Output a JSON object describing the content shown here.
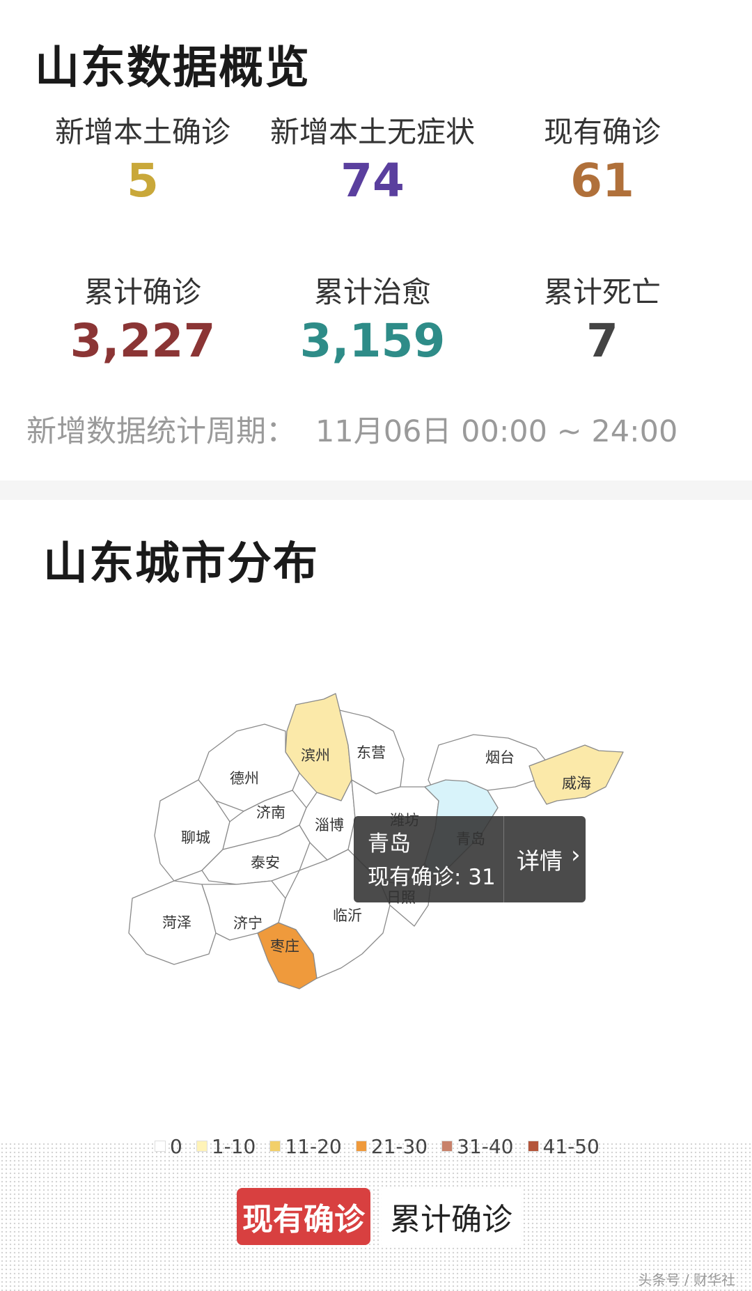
{
  "overview": {
    "title": "山东数据概览",
    "stats": [
      {
        "label": "新增本土确诊",
        "value": "5",
        "color": "#c9a83a"
      },
      {
        "label": "新增本土无症状",
        "value": "74",
        "color": "#5a3f9e"
      },
      {
        "label": "现有确诊",
        "value": "61",
        "color": "#b0703a"
      },
      {
        "label": "累计确诊",
        "value": "3,227",
        "color": "#8b3535"
      },
      {
        "label": "累计治愈",
        "value": "3,159",
        "color": "#2e8c88"
      },
      {
        "label": "累计死亡",
        "value": "7",
        "color": "#444444"
      }
    ],
    "period_label": "新增数据统计周期：",
    "period_value": "11月06日 00:00 ~ 24:00"
  },
  "city": {
    "title": "山东城市分布",
    "cities": [
      "滨州",
      "东营",
      "烟台",
      "德州",
      "威海",
      "济南",
      "淄博",
      "潍坊",
      "青岛",
      "聊城",
      "泰安",
      "日照",
      "菏泽",
      "济宁",
      "临沂",
      "枣庄"
    ],
    "tooltip": {
      "city": "青岛",
      "metric": "现有确诊: 31",
      "detail": "详情"
    },
    "legend": [
      {
        "label": "0",
        "color": "#ffffff"
      },
      {
        "label": "1-10",
        "color": "#fff3b8"
      },
      {
        "label": "11-20",
        "color": "#f2cf6a"
      },
      {
        "label": "21-30",
        "color": "#ef9a3c"
      },
      {
        "label": "31-40",
        "color": "#c8826b"
      },
      {
        "label": "41-50",
        "color": "#b4553a"
      }
    ],
    "tabs": [
      "现有确诊",
      "累计确诊"
    ]
  },
  "watermark": "头条号 / 财华社"
}
